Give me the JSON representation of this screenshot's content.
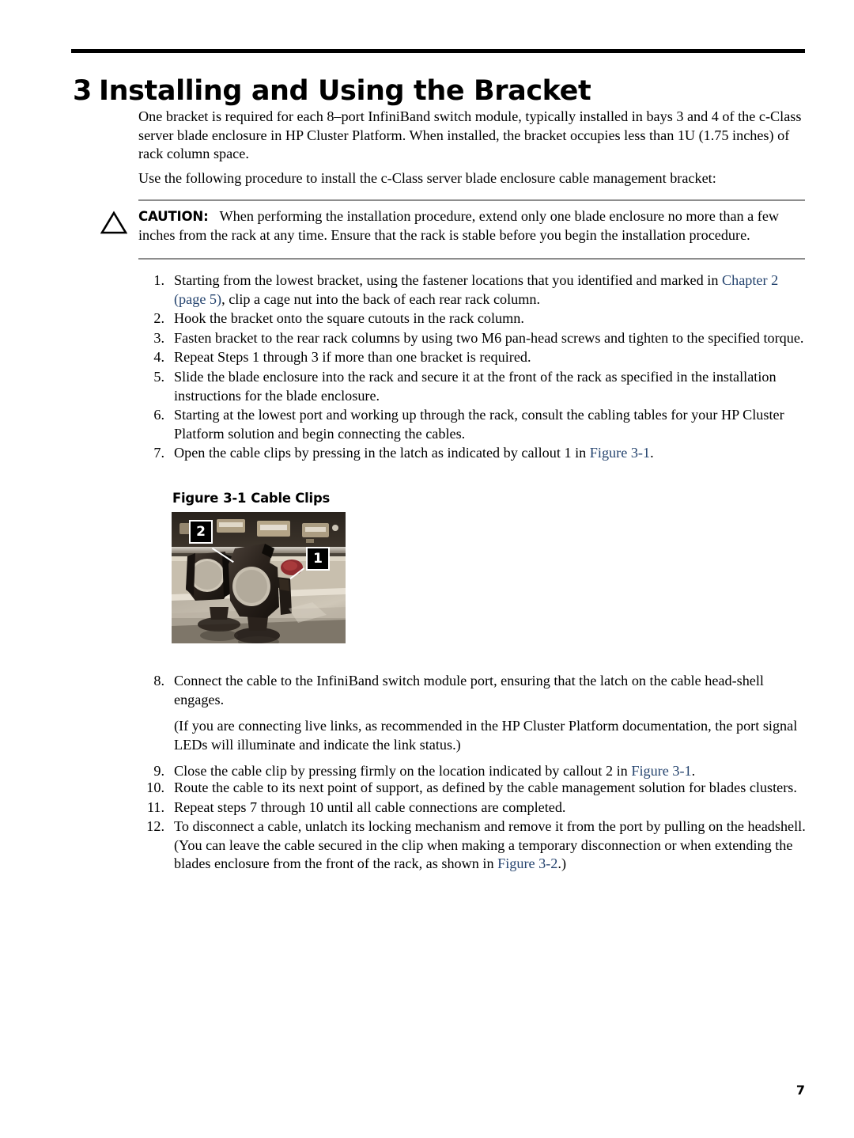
{
  "chapter": {
    "number": "3",
    "title": "Installing and Using the Bracket"
  },
  "intro": {
    "paragraph_1": "One bracket is required for each 8–port InfiniBand switch module, typically installed in bays 3 and 4 of the c-Class server blade enclosure in HP Cluster Platform. When installed, the bracket occupies less than 1U (1.75 inches) of rack column space.",
    "paragraph_2": "Use the following procedure to install the c-Class server blade enclosure cable management bracket:"
  },
  "caution": {
    "icon": "warning-triangle-icon",
    "label": "CAUTION:",
    "text": "When performing the installation procedure, extend only one blade enclosure no more than a few inches from the rack at any time. Ensure that the rack is stable before you begin the installation procedure."
  },
  "steps": [
    {
      "marker": "1.",
      "text_before": "Starting from the lowest bracket, using the fastener locations that you identified and marked in ",
      "link": "Chapter 2 (page 5)",
      "text_after": ", clip a cage nut into the back of each rear rack column."
    },
    {
      "marker": "2.",
      "text_before": "Hook the bracket onto the square cutouts in the rack column.",
      "link": "",
      "text_after": ""
    },
    {
      "marker": "3.",
      "text_before": "Fasten bracket to the rear rack columns by using two M6 pan-head screws and tighten to the specified torque.",
      "link": "",
      "text_after": ""
    },
    {
      "marker": "4.",
      "text_before": "Repeat Steps 1 through 3 if more than one bracket is required.",
      "link": "",
      "text_after": ""
    },
    {
      "marker": "5.",
      "text_before": "Slide the blade enclosure into the rack and secure it at the front of the rack as specified in the installation instructions for the blade enclosure.",
      "link": "",
      "text_after": ""
    },
    {
      "marker": "6.",
      "text_before": "Starting at the lowest port and working up through the rack, consult the cabling tables for your HP Cluster Platform solution and begin connecting the cables.",
      "link": "",
      "text_after": ""
    },
    {
      "marker": "7.",
      "text_before": "Open the cable clips by pressing in the latch as indicated by callout 1 in ",
      "link": "Figure 3-1",
      "text_after": "."
    }
  ],
  "figure": {
    "caption_label": "Figure",
    "caption_number": "3-1",
    "caption_title": "Cable Clips",
    "alt": "Photograph of two black plastic cable clips mounted on a metal rail in front of a server chassis",
    "callouts": [
      {
        "id": "2",
        "label": "2"
      },
      {
        "id": "1",
        "label": "1"
      }
    ]
  },
  "steps_after_figure": [
    {
      "marker": "8.",
      "text_before": "Connect the cable to the InfiniBand switch module port, ensuring that the latch on the cable head-shell engages.",
      "link": "",
      "text_after": "",
      "sub": "(If you are connecting live links, as recommended in the HP Cluster Platform documentation, the port signal LEDs will illuminate and indicate the link status.)"
    },
    {
      "marker": "9.",
      "text_before": "Close the cable clip by pressing firmly on the location indicated by callout 2 in ",
      "link": "Figure 3-1",
      "text_after": "."
    }
  ],
  "steps_final": [
    {
      "marker": "10.",
      "text_before": "Route the cable to its next point of support, as defined by the cable management solution for blades clusters.",
      "link": "",
      "text_after": ""
    },
    {
      "marker": "11.",
      "text_before": "Repeat steps 7 through 10 until all cable connections are completed.",
      "link": "",
      "text_after": ""
    },
    {
      "marker": "12.",
      "text_before": "To disconnect a cable, unlatch its locking mechanism and remove it from the port by pulling on the headshell. (You can leave the cable secured in the clip when making a temporary disconnection or when extending the blades enclosure from the front of the rack, as shown in ",
      "link": "Figure 3-2",
      "text_after": ".)"
    }
  ],
  "footer": {
    "page_number": "7"
  },
  "colors": {
    "link": "#24436e",
    "rule": "#000000",
    "admonition_rule": "#8d8d8d",
    "text": "#000000"
  }
}
